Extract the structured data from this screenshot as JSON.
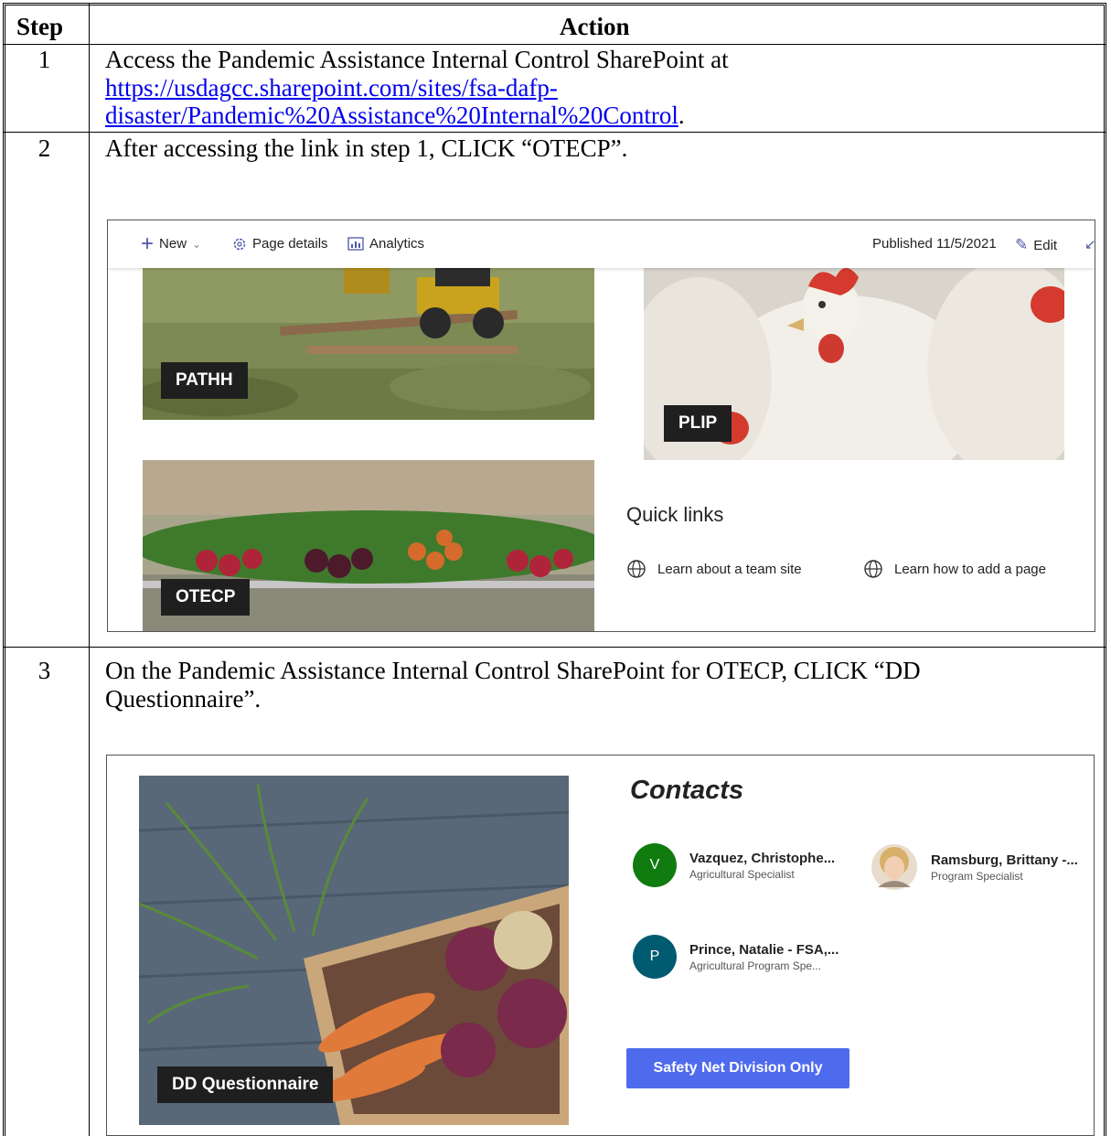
{
  "table": {
    "col_step": "Step",
    "col_action": "Action"
  },
  "steps": [
    {
      "num": "1",
      "text": "Access the Pandemic Assistance Internal Control SharePoint at",
      "link_line1": "https://usdagcc.sharepoint.com/sites/fsa-dafp-",
      "link_line2": "disaster/Pandemic%20Assistance%20Internal%20Control",
      "after_link": "."
    },
    {
      "num": "2",
      "text": "After accessing the link in step 1, CLICK “OTECP”."
    },
    {
      "num": "3",
      "text_line1": "On the Pandemic Assistance Internal Control SharePoint for OTECP, CLICK “DD",
      "text_line2": "Questionnaire”."
    }
  ],
  "shot1": {
    "new_label": "New",
    "page_details": "Page details",
    "analytics": "Analytics",
    "published": "Published 11/5/2021",
    "edit": "Edit",
    "tiles": [
      "PATHH",
      "PLIP",
      "OTECP"
    ],
    "quick_links_title": "Quick links",
    "quick_links": [
      "Learn about a team site",
      "Learn how to add a page"
    ]
  },
  "shot2": {
    "tile": "DD Questionnaire",
    "contacts_title": "Contacts",
    "contacts": [
      {
        "initial": "V",
        "name": "Vazquez, Christophe...",
        "role": "Agricultural Specialist",
        "color": "#107c10"
      },
      {
        "initial": "",
        "name": "Ramsburg, Brittany -...",
        "role": "Program Specialist",
        "color": "#d9b38c"
      },
      {
        "initial": "P",
        "name": "Prince, Natalie - FSA,...",
        "role": "Agricultural Program Spe...",
        "color": "#005b70"
      }
    ],
    "button": "Safety Net Division Only"
  }
}
